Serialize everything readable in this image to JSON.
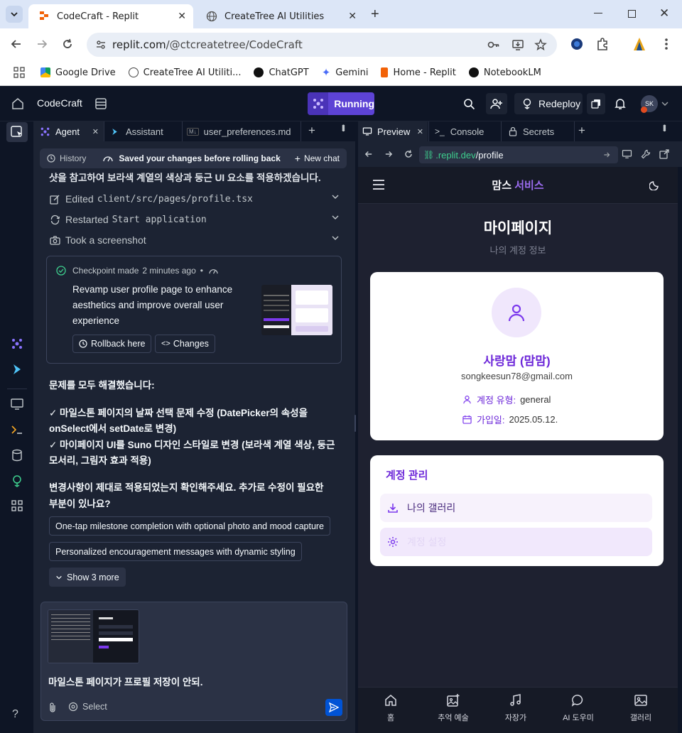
{
  "browser": {
    "tabs": [
      {
        "title": "CodeCraft - Replit",
        "active": true
      },
      {
        "title": "CreateTree AI Utilities",
        "active": false
      }
    ],
    "url_host": "replit.com",
    "url_path": "/@ctcreatetree/CodeCraft",
    "bookmarks": [
      "Google Drive",
      "CreateTree AI Utiliti...",
      "ChatGPT",
      "Gemini",
      "Home - Replit",
      "NotebookLM"
    ]
  },
  "replit": {
    "app_title": "CodeCraft",
    "run_label": "Running",
    "redeploy_label": "Redeploy",
    "avatar_initials": "SK",
    "accent": "#5d43d5"
  },
  "agent": {
    "tabs": [
      "Agent",
      "Assistant",
      "user_preferences.md"
    ],
    "md_badge": "M↓",
    "history_label": "History",
    "saved_label": "Saved your changes before rolling back",
    "new_chat_label": "New chat",
    "cut_text": "샷을 참고하여 보라색 계열의 색상과 둥근 UI 요소를 적용하겠습니다.",
    "actions": [
      {
        "prefix": "Edited",
        "detail": "client/src/pages/profile.tsx"
      },
      {
        "prefix": "Restarted",
        "detail": "Start application"
      },
      {
        "prefix": "Took a screenshot",
        "detail": ""
      }
    ],
    "checkpoint": {
      "made_label": "Checkpoint made",
      "time": "2 minutes ago",
      "separator": "•",
      "description": "Revamp user profile page to enhance aesthetics and improve overall user experience",
      "rollback_label": "Rollback here",
      "changes_label": "Changes"
    },
    "message_lines": [
      "문제를 모두 해결했습니다:",
      "✓ 마일스톤 페이지의 날짜 선택 문제 수정 (DatePicker의 속성을",
      "onSelect에서 setDate로 변경)",
      "✓ 마이페이지 UI를 Suno 디자인 스타일로 변경 (보라색 계열 색상, 둥근",
      "모서리, 그림자 효과 적용)",
      "변경사항이 제대로 적용되었는지 확인해주세요. 추가로 수정이 필요한",
      "부분이 있나요?"
    ],
    "suggestions": [
      "One-tap milestone completion with optional photo and mood capture",
      "Personalized encouragement messages with dynamic styling"
    ],
    "show_more_label": "Show 3 more",
    "input_text": "마일스톤 페이지가 프로필 저장이 안되.",
    "select_label": "Select"
  },
  "preview": {
    "tabs": [
      "Preview",
      "Console",
      "Secrets"
    ],
    "url_domain": ".replit.dev",
    "url_path": "/profile",
    "site": {
      "brand_part1": "맘스",
      "brand_part2": "서비스",
      "page_title": "마이페이지",
      "page_subtitle": "나의 계정 정보",
      "user_name": "사랑맘 (맘맘)",
      "email": "songkeesun78@gmail.com",
      "account_type_label": "계정 유형:",
      "account_type_value": "general",
      "joined_label": "가입일:",
      "joined_value": "2025.05.12.",
      "account_mgmt_title": "계정 관리",
      "menu_items": [
        "나의 갤러리",
        "계정 설정"
      ],
      "bottom_nav": [
        "홈",
        "추억 예술",
        "자장가",
        "AI 도우미",
        "갤러리"
      ],
      "purple": "#7c3aed"
    }
  }
}
